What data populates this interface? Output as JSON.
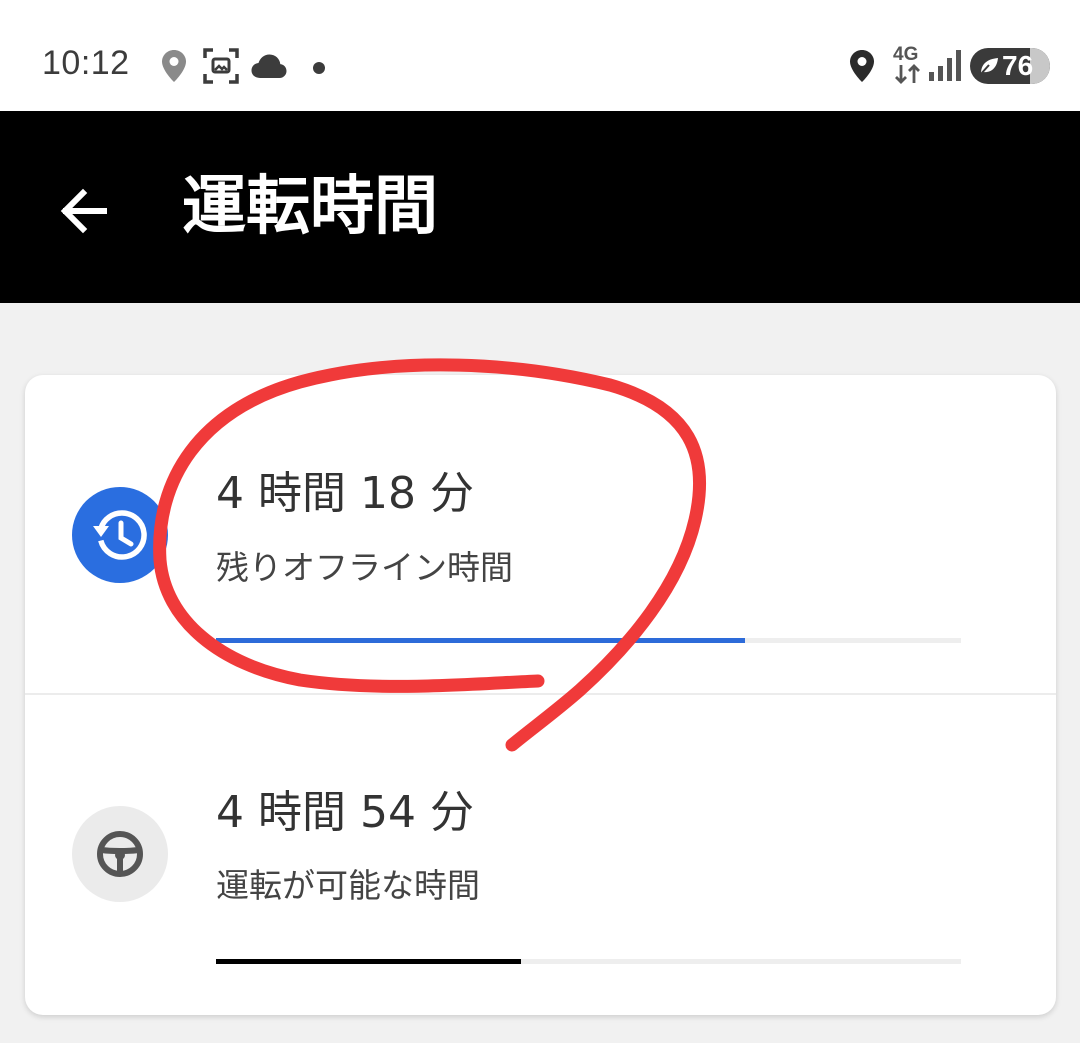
{
  "status_bar": {
    "time": "10:12",
    "left_icons": [
      "location-pin-icon",
      "screenshot-icon",
      "cloud-icon",
      "notification-dot-icon"
    ],
    "right_icons": [
      "location-pin-icon",
      "4g-data-icon",
      "signal-icon"
    ],
    "network": "4G",
    "battery_percent": "76"
  },
  "app_bar": {
    "title": "運転時間",
    "back_icon": "arrow-back-icon"
  },
  "rows": [
    {
      "value": "4 時間 18 分",
      "label": "残りオフライン時間",
      "icon": "history-clock-icon",
      "icon_bg": "#2a6ee0",
      "bar_color": "#2d6bd9",
      "progress": 0.71
    },
    {
      "value": "4 時間 54 分",
      "label": "運転が可能な時間",
      "icon": "steering-wheel-icon",
      "icon_bg": "#ebebeb",
      "bar_color": "#000000",
      "progress": 0.41
    }
  ],
  "colors": {
    "annotation": "#f03a3a"
  }
}
